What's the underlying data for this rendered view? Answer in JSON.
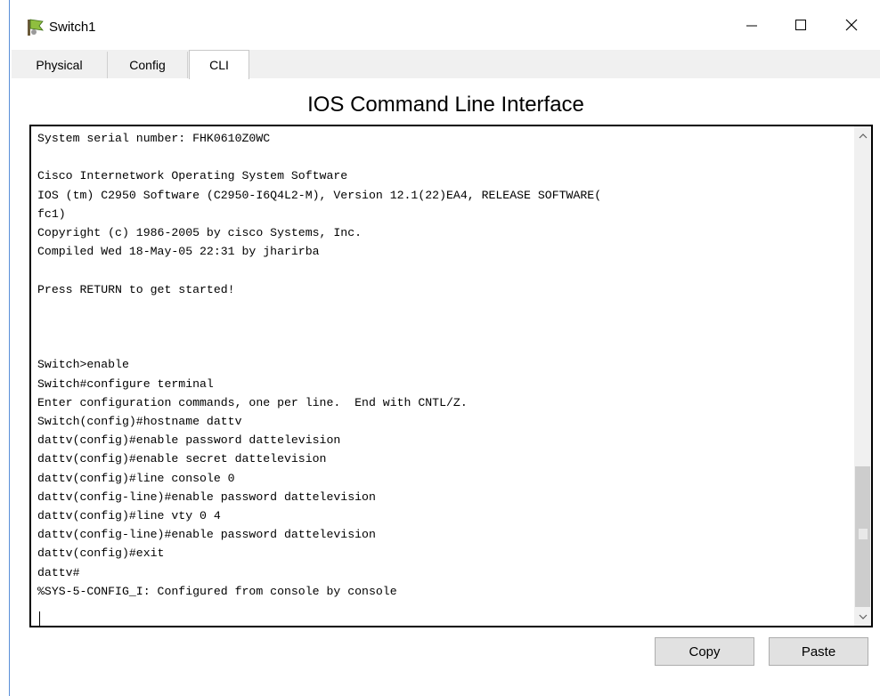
{
  "window": {
    "title": "Switch1",
    "minimize_glyph": "—",
    "maximize_glyph": "☐",
    "close_glyph": "✕"
  },
  "tabs": [
    {
      "label": "Physical",
      "active": false
    },
    {
      "label": "Config",
      "active": false
    },
    {
      "label": "CLI",
      "active": true
    }
  ],
  "cli": {
    "heading": "IOS Command Line Interface",
    "output": "System serial number: FHK0610Z0WC\n\nCisco Internetwork Operating System Software\nIOS (tm) C2950 Software (C2950-I6Q4L2-M), Version 12.1(22)EA4, RELEASE SOFTWARE(\nfc1)\nCopyright (c) 1986-2005 by cisco Systems, Inc.\nCompiled Wed 18-May-05 22:31 by jharirba\n\nPress RETURN to get started!\n\n\n\nSwitch>enable\nSwitch#configure terminal\nEnter configuration commands, one per line.  End with CNTL/Z.\nSwitch(config)#hostname dattv\ndattv(config)#enable password dattelevision\ndattv(config)#enable secret dattelevision\ndattv(config)#line console 0\ndattv(config-line)#enable password dattelevision\ndattv(config)#line vty 0 4\ndattv(config-line)#enable password dattelevision\ndattv(config)#exit\ndattv#\n%SYS-5-CONFIG_I: Configured from console by console"
  },
  "buttons": {
    "copy": "Copy",
    "paste": "Paste"
  },
  "colors": {
    "tab_bar": "#f0f0f0",
    "button_face": "#e1e1e1",
    "terminal_border": "#000000",
    "scroll_thumb": "#cdcdcd"
  },
  "icons": {
    "app": "switch-icon",
    "scroll_up": "chevron-up-icon",
    "scroll_down": "chevron-down-icon"
  }
}
